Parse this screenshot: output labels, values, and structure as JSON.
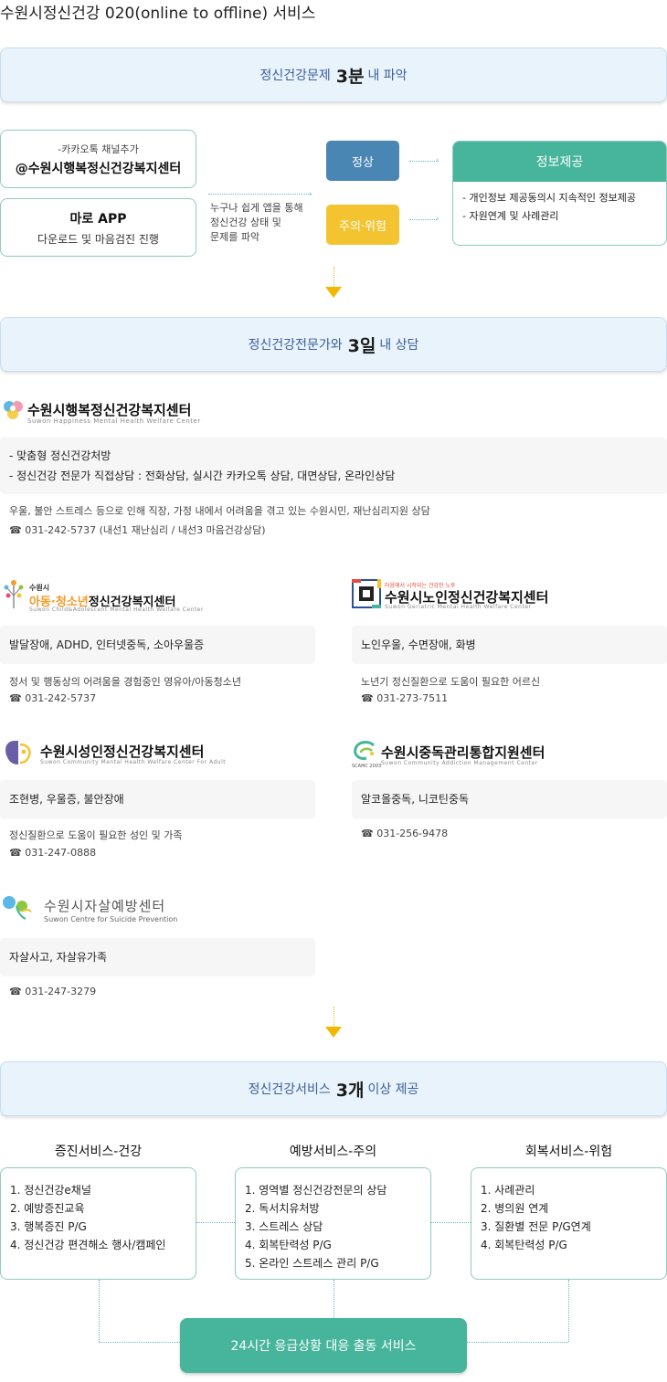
{
  "title": "수원시정신건강 020(online to offline) 서비스",
  "banner1": {
    "pre": "정신건강문제",
    "big": "3분",
    "post": "내  파악"
  },
  "kakao": {
    "line1": "-카카오톡 채널추가",
    "line2": "@수원시행복정신건강복지센터"
  },
  "app": {
    "line1": "마로 APP",
    "line2": "다운로드 및 마음검진 진행"
  },
  "middle_note": [
    "누구나 쉽게 앱을 통해",
    "정신건강 상태 및",
    "문제를 파악"
  ],
  "status": {
    "normal": "정상",
    "caution": "주의·위험"
  },
  "info": {
    "header": "정보제공",
    "items": [
      "- 개인정보 제공동의시 지속적인 정보제공",
      "- 자원연계 및 사례관리"
    ]
  },
  "banner2": {
    "pre": "정신건강전문가와",
    "big": "3일",
    "post": "내  상담"
  },
  "happy_center": {
    "name": "수원시행복정신건강복지센터",
    "sub": "Suwon Happiness Mental Health Welfare Center",
    "items": [
      "- 맞춤형 정신건강처방",
      "- 정신건강 전문가 직접상담 : 전화상담, 실시간 카카오톡 상담, 대면상담, 온라인상담"
    ],
    "desc": "우울, 불안 스트레스 등으로 인해 직장, 가정 내에서 어려움을 겪고 있는 수원시민, 재난심리지원 상담",
    "phone": "☎ 031-242-5737 (내선1 재난심리 / 내선3 마음건강상담)"
  },
  "child_center": {
    "small": "수원시",
    "name_a": "아동·청소년",
    "name_b": "정신건강복지센터",
    "sub": "Suwon Child&Adolescent Mental Health Welfare Center",
    "box": "발달장애, ADHD, 인터넷중독, 소아우울증",
    "desc": "정서 및 행동상의 어려움을 경험중인 영유아/아동청소년",
    "phone": "☎ 031-242-5737"
  },
  "elder_center": {
    "tag": "마음에서 시작되는 건강한 노후",
    "name": "수원시노인정신건강복지센터",
    "sub": "Suwon Geriatric Mental Health Welfare Center",
    "box": "노인우울, 수면장애, 화병",
    "desc": "노년기 정신질환으로 도움이 필요한 어르신",
    "phone": "☎ 031-273-7511"
  },
  "adult_center": {
    "name": "수원시성인정신건강복지센터",
    "sub": "Suwon Community Mental Health Welfare Center For Adult",
    "box": "조현병, 우울증, 불안장애",
    "desc": "정신질환으로 도움이 필요한 성인 및 가족",
    "phone": "☎ 031-247-0888"
  },
  "addiction_center": {
    "name": "수원시중독관리통합지원센터",
    "sub": "Suwon Community Addiction Management Center",
    "tag": "SCAMC 2003",
    "box": "알코올중독, 니코틴중독",
    "phone": "☎ 031-256-9478"
  },
  "suicide_center": {
    "name": "수원시자살예방센터",
    "sub": "Suwon Centre for Suicide Prevention",
    "box": "자살사고, 자살유가족",
    "phone": "☎ 031-247-3279"
  },
  "banner3": {
    "pre": "정신건강서비스",
    "big": "3개",
    "post": "이상 제공"
  },
  "services": [
    {
      "title": "증진서비스-건강",
      "items": [
        "1. 정신건강e채널",
        "2. 예방증진교육",
        "3. 행복증진 P/G",
        "4. 정신건강 편견해소 행사/캠페인"
      ]
    },
    {
      "title": "예방서비스-주의",
      "items": [
        "1. 영역별 정신건강전문의 상담",
        "2. 독서치유처방",
        "3. 스트레스 상담",
        "4. 회복탄력성 P/G",
        "5. 온라인 스트레스 관리 P/G"
      ]
    },
    {
      "title": "회복서비스-위험",
      "items": [
        "1. 사례관리",
        "2. 병의원 연계",
        "3. 질환별 전문 P/G연계",
        "4. 회복탄력성 P/G"
      ]
    }
  ],
  "emergency": "24시간 응급상황 대응 출동 서비스",
  "colors": {
    "accent": "#46b59b",
    "normal": "#4a86b4",
    "caution": "#f4c430",
    "banner_bg": "#e9f3fb",
    "arrow": "#f2b800"
  }
}
